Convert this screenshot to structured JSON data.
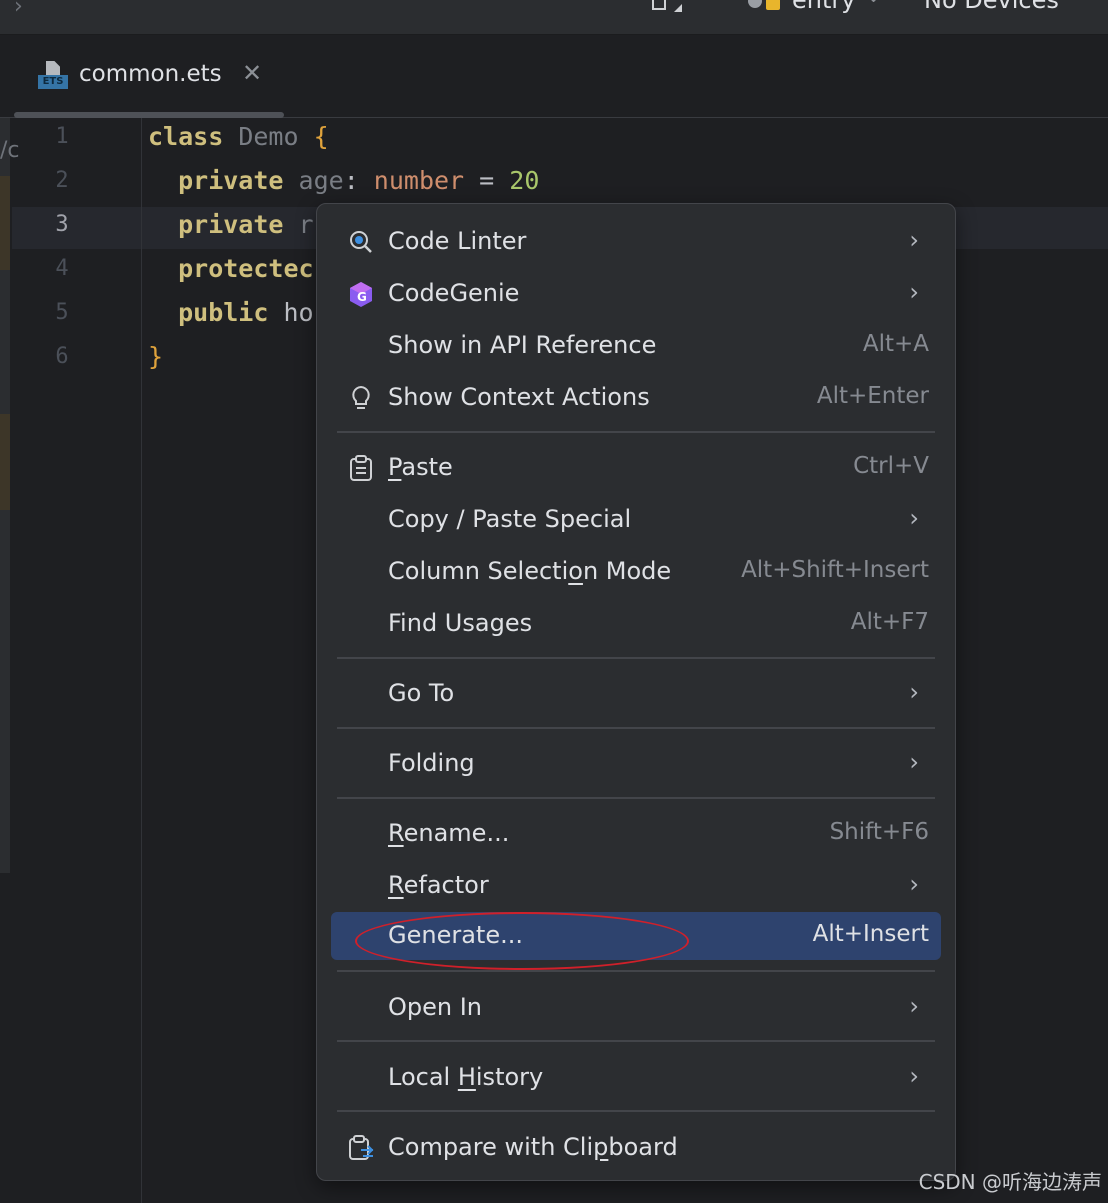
{
  "toolbar": {
    "module": "entry",
    "device": "No Devices"
  },
  "tab": {
    "file_badge": "ETS",
    "title": "common.ets"
  },
  "editor": {
    "line_numbers": [
      "1",
      "2",
      "3",
      "4",
      "5",
      "6"
    ],
    "active_line": "3",
    "lines": [
      [
        {
          "t": "class",
          "c": "kw"
        },
        {
          "t": " Demo ",
          "c": "nm"
        },
        {
          "t": "{",
          "c": "br"
        }
      ],
      [
        {
          "t": "  private",
          "c": "kw"
        },
        {
          "t": " age",
          "c": "nm"
        },
        {
          "t": ": ",
          "c": "pl"
        },
        {
          "t": "number",
          "c": "ty"
        },
        {
          "t": " = ",
          "c": "pl"
        },
        {
          "t": "20",
          "c": "num"
        }
      ],
      [
        {
          "t": "  private",
          "c": "kw"
        },
        {
          "t": " r",
          "c": "nm"
        }
      ],
      [
        {
          "t": "  protectec",
          "c": "kw"
        }
      ],
      [
        {
          "t": "  public",
          "c": "kw"
        },
        {
          "t": " ho",
          "c": "pl"
        }
      ],
      [
        {
          "t": "}",
          "c": "br"
        }
      ]
    ]
  },
  "context_menu": {
    "items": [
      {
        "label": "Code Linter",
        "shortcut": "",
        "submenu": true,
        "icon": "code-linter-icon"
      },
      {
        "label": "CodeGenie",
        "shortcut": "",
        "submenu": true,
        "icon": "codegenie-icon"
      },
      {
        "label": "Show in API Reference",
        "shortcut": "Alt+A",
        "submenu": false,
        "icon": ""
      },
      {
        "label": "Show Context Actions",
        "shortcut": "Alt+Enter",
        "submenu": false,
        "icon": "lightbulb-icon"
      },
      {
        "label": "Paste",
        "shortcut": "Ctrl+V",
        "submenu": false,
        "icon": "clipboard-icon"
      },
      {
        "label": "Copy / Paste Special",
        "shortcut": "",
        "submenu": true,
        "icon": ""
      },
      {
        "label": "Column Selection Mode",
        "shortcut": "Alt+Shift+Insert",
        "submenu": false,
        "icon": ""
      },
      {
        "label": "Find Usages",
        "shortcut": "Alt+F7",
        "submenu": false,
        "icon": ""
      },
      {
        "label": "Go To",
        "shortcut": "",
        "submenu": true,
        "icon": ""
      },
      {
        "label": "Folding",
        "shortcut": "",
        "submenu": true,
        "icon": ""
      },
      {
        "label": "Rename...",
        "shortcut": "Shift+F6",
        "submenu": false,
        "icon": ""
      },
      {
        "label": "Refactor",
        "shortcut": "",
        "submenu": true,
        "icon": ""
      },
      {
        "label": "Generate...",
        "shortcut": "Alt+Insert",
        "submenu": false,
        "icon": "",
        "selected": true
      },
      {
        "label": "Open In",
        "shortcut": "",
        "submenu": true,
        "icon": ""
      },
      {
        "label": "Local History",
        "shortcut": "",
        "submenu": true,
        "icon": ""
      },
      {
        "label": "Compare with Clipboard",
        "shortcut": "",
        "submenu": false,
        "icon": "compare-clipboard-icon"
      }
    ]
  },
  "watermark": "CSDN @听海边涛声",
  "colors": {
    "selection": "#2e436e",
    "annotation": "#d0202a"
  }
}
